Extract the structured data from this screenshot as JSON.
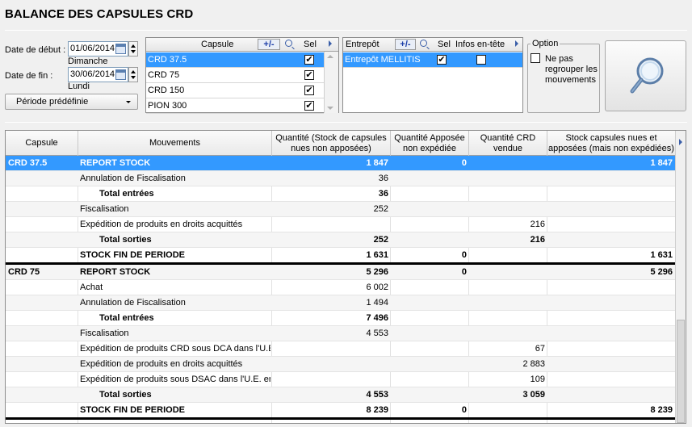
{
  "page_title": "BALANCE DES CAPSULES CRD",
  "dates": {
    "start_label": "Date de début :",
    "start_value": "01/06/2014",
    "start_day": "Dimanche",
    "end_label": "Date de fin :",
    "end_value": "30/06/2014",
    "end_day": "Lundi",
    "period_button": "Période prédéfinie"
  },
  "capsule_panel": {
    "header": "Capsule",
    "plus_minus": "+/-",
    "sel_header": "Sel",
    "rows": [
      {
        "name": "CRD 37.5",
        "checked": true,
        "selected": true
      },
      {
        "name": "CRD 75",
        "checked": true,
        "selected": false
      },
      {
        "name": "CRD 150",
        "checked": true,
        "selected": false
      },
      {
        "name": "PION 300",
        "checked": true,
        "selected": false
      }
    ]
  },
  "entrepot_panel": {
    "header": "Entrepôt",
    "plus_minus": "+/-",
    "sel_header": "Sel",
    "infos_header": "Infos en-tête",
    "rows": [
      {
        "name": "Entrepôt MELLITIS",
        "checked": true,
        "infos_checked": false,
        "selected": true
      }
    ]
  },
  "option": {
    "legend": "Option",
    "checkbox_label": "Ne pas regrouper les mouvements",
    "checked": false
  },
  "grid": {
    "headers": [
      "Capsule",
      "Mouvements",
      "Quantité (Stock de capsules nues non apposées)",
      "Quantité Apposée non expédiée",
      "Quantité CRD vendue",
      "Stock capsules nues et apposées (mais non expédiées)"
    ],
    "rows": [
      {
        "capsule": "CRD 37.5",
        "mvt": "REPORT STOCK",
        "q1": "1 847",
        "q2": "0",
        "q3": "",
        "q4": "1 847",
        "style": "sel"
      },
      {
        "capsule": "",
        "mvt": "Annulation de Fiscalisation",
        "q1": "36",
        "q2": "",
        "q3": "",
        "q4": "",
        "style": ""
      },
      {
        "capsule": "",
        "mvt": "Total entrées",
        "q1": "36",
        "q2": "",
        "q3": "",
        "q4": "",
        "style": "total"
      },
      {
        "capsule": "",
        "mvt": "Fiscalisation",
        "q1": "252",
        "q2": "",
        "q3": "",
        "q4": "",
        "style": ""
      },
      {
        "capsule": "",
        "mvt": "Expédition de produits en droits acquittés",
        "q1": "",
        "q2": "",
        "q3": "216",
        "q4": "",
        "style": ""
      },
      {
        "capsule": "",
        "mvt": "Total sorties",
        "q1": "252",
        "q2": "",
        "q3": "216",
        "q4": "",
        "style": "total"
      },
      {
        "capsule": "",
        "mvt": "STOCK FIN DE PERIODE",
        "q1": "1 631",
        "q2": "0",
        "q3": "",
        "q4": "1 631",
        "style": "end"
      },
      {
        "capsule": "CRD 75",
        "mvt": "REPORT STOCK",
        "q1": "5 296",
        "q2": "0",
        "q3": "",
        "q4": "5 296",
        "style": "head"
      },
      {
        "capsule": "",
        "mvt": "Achat",
        "q1": "6 002",
        "q2": "",
        "q3": "",
        "q4": "",
        "style": ""
      },
      {
        "capsule": "",
        "mvt": "Annulation de Fiscalisation",
        "q1": "1 494",
        "q2": "",
        "q3": "",
        "q4": "",
        "style": ""
      },
      {
        "capsule": "",
        "mvt": "Total entrées",
        "q1": "7 496",
        "q2": "",
        "q3": "",
        "q4": "",
        "style": "total"
      },
      {
        "capsule": "",
        "mvt": "Fiscalisation",
        "q1": "4 553",
        "q2": "",
        "q3": "",
        "q4": "",
        "style": ""
      },
      {
        "capsule": "",
        "mvt": "Expédition de produits CRD sous DCA dans l'U.E.",
        "q1": "",
        "q2": "",
        "q3": "67",
        "q4": "",
        "style": ""
      },
      {
        "capsule": "",
        "mvt": "Expédition de produits en droits acquittés",
        "q1": "",
        "q2": "",
        "q3": "2 883",
        "q4": "",
        "style": ""
      },
      {
        "capsule": "",
        "mvt": "Expédition de produits sous DSAC dans l'U.E. en c",
        "q1": "",
        "q2": "",
        "q3": "109",
        "q4": "",
        "style": ""
      },
      {
        "capsule": "",
        "mvt": "Total sorties",
        "q1": "4 553",
        "q2": "",
        "q3": "3 059",
        "q4": "",
        "style": "total"
      },
      {
        "capsule": "",
        "mvt": "STOCK FIN DE PERIODE",
        "q1": "8 239",
        "q2": "0",
        "q3": "",
        "q4": "8 239",
        "style": "end"
      }
    ]
  },
  "icons": {
    "search": "magnifier-icon",
    "calendar": "calendar-icon",
    "find": "find-icon"
  },
  "colors": {
    "selection": "#3399ff",
    "accent_text": "#1b3da8"
  }
}
